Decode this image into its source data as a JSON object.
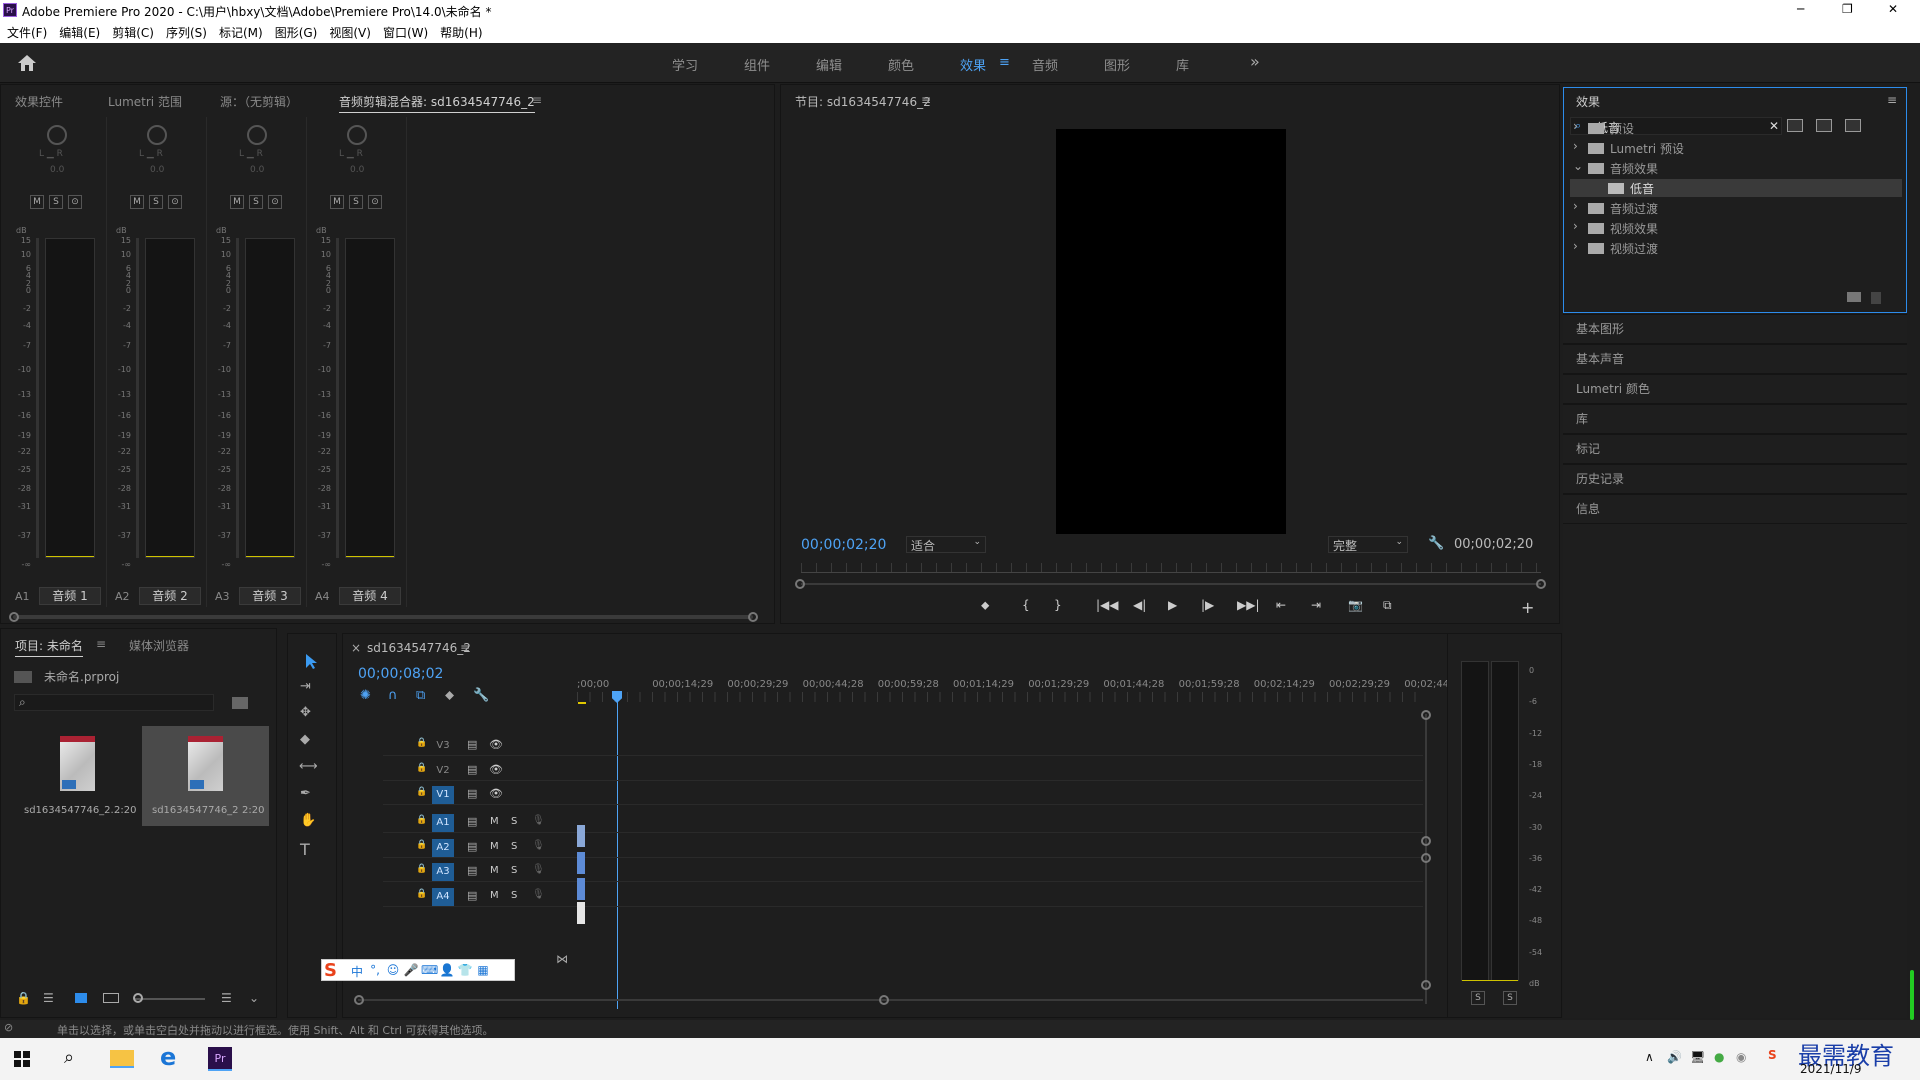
{
  "app": {
    "title": "Adobe Premiere Pro 2020 - C:\\用户\\hbxy\\文档\\Adobe\\Premiere Pro\\14.0\\未命名 *",
    "icon_text": "Pr"
  },
  "window_controls": {
    "min": "─",
    "max": "❐",
    "close": "✕"
  },
  "menu": [
    "文件(F)",
    "编辑(E)",
    "剪辑(C)",
    "序列(S)",
    "标记(M)",
    "图形(G)",
    "视图(V)",
    "窗口(W)",
    "帮助(H)"
  ],
  "workspaces": {
    "items": [
      "学习",
      "组件",
      "编辑",
      "颜色",
      "效果",
      "音频",
      "图形",
      "库"
    ],
    "active": "效果",
    "more": "»",
    "menu_glyph": "≡"
  },
  "mixer": {
    "tabs": [
      "效果控件",
      "Lumetri 范围",
      "源：（无剪辑）",
      "音频剪辑混合器: sd1634547746_2"
    ],
    "tab_menu": "≡",
    "lr": "L ▁ R",
    "pan_value": "0.0",
    "m": "M",
    "s": "S",
    "rec": "⊙",
    "db_label": "dB",
    "db_scale": [
      "15",
      "10",
      "6",
      "4",
      "2",
      "0",
      "-2",
      "-4",
      "-7",
      "-10",
      "-13",
      "-16",
      "-19",
      "-22",
      "-25",
      "-28",
      "-31",
      "-37",
      "-∞"
    ],
    "channels": [
      {
        "id": "A1",
        "name": "音频 1"
      },
      {
        "id": "A2",
        "name": "音频 2"
      },
      {
        "id": "A3",
        "name": "音频 3"
      },
      {
        "id": "A4",
        "name": "音频 4"
      }
    ]
  },
  "program": {
    "title": "节目: sd1634547746_2",
    "menu": "≡",
    "timecode_left": "00;00;02;20",
    "fit": "适合",
    "quality": "完整",
    "timecode_right": "00;00;02;20",
    "transport": [
      "⬥",
      "{",
      "}",
      "|◀◀",
      "◀|",
      "▶",
      "|▶",
      "▶▶|",
      "⇤",
      "⇥",
      "📷",
      "⧉"
    ],
    "add": "+"
  },
  "project": {
    "tabs": [
      "项目: 未命名",
      "媒体浏览器"
    ],
    "tab_menu": "≡",
    "file": "未命名.prproj",
    "clips": [
      {
        "name": "sd1634547746_2...",
        "dur": "2:20"
      },
      {
        "name": "sd1634547746_2",
        "dur": "2:20"
      }
    ]
  },
  "timeline": {
    "tab": "sd1634547746_2",
    "tab_close": "×",
    "tab_menu": "≡",
    "timecode": "00;00;08;02",
    "ruler": [
      ";00;00",
      "00;00;14;29",
      "00;00;29;29",
      "00;00;44;28",
      "00;00;59;28",
      "00;01;14;29",
      "00;01;29;29",
      "00;01;44;28",
      "00;01;59;28",
      "00;02;14;29",
      "00;02;29;29",
      "00;02;44;"
    ],
    "tracks": [
      {
        "id": "V3",
        "type": "v"
      },
      {
        "id": "V2",
        "type": "v"
      },
      {
        "id": "V1",
        "type": "v",
        "sel": true
      },
      {
        "id": "A1",
        "type": "a",
        "sel": true
      },
      {
        "id": "A2",
        "type": "a",
        "sel": true
      },
      {
        "id": "A3",
        "type": "a",
        "sel": true
      },
      {
        "id": "A4",
        "type": "a",
        "sel": true
      }
    ],
    "m": "M",
    "s": "S"
  },
  "ime": {
    "main": "中",
    "dot": "°,"
  },
  "meters": {
    "scale": [
      "0",
      "-6",
      "-12",
      "-18",
      "-24",
      "-30",
      "-36",
      "-42",
      "-48",
      "-54",
      "dB"
    ],
    "s": "S"
  },
  "effects": {
    "title": "效果",
    "menu": "≡",
    "search": "低音",
    "tree": [
      {
        "label": "预设",
        "level": 0,
        "state": "closed"
      },
      {
        "label": "Lumetri 预设",
        "level": 0,
        "state": "closed"
      },
      {
        "label": "音频效果",
        "level": 0,
        "state": "open"
      },
      {
        "label": "低音",
        "level": 1,
        "state": "leaf"
      },
      {
        "label": "音频过渡",
        "level": 0,
        "state": "closed"
      },
      {
        "label": "视频效果",
        "level": 0,
        "state": "closed"
      },
      {
        "label": "视频过渡",
        "level": 0,
        "state": "closed"
      }
    ]
  },
  "side_panels": [
    "基本图形",
    "基本声音",
    "Lumetri 颜色",
    "库",
    "标记",
    "历史记录",
    "信息"
  ],
  "status": "单击以选择，或单击空白处并拖动以进行框选。使用 Shift、Alt 和 Ctrl 可获得其他选项。",
  "taskbar": {
    "date": "2021/11/9",
    "watermark": "最需教育"
  },
  "colors": {
    "accent": "#4ea3f5",
    "selection": "#1f5d96",
    "premiere": "#2a0f4a"
  }
}
